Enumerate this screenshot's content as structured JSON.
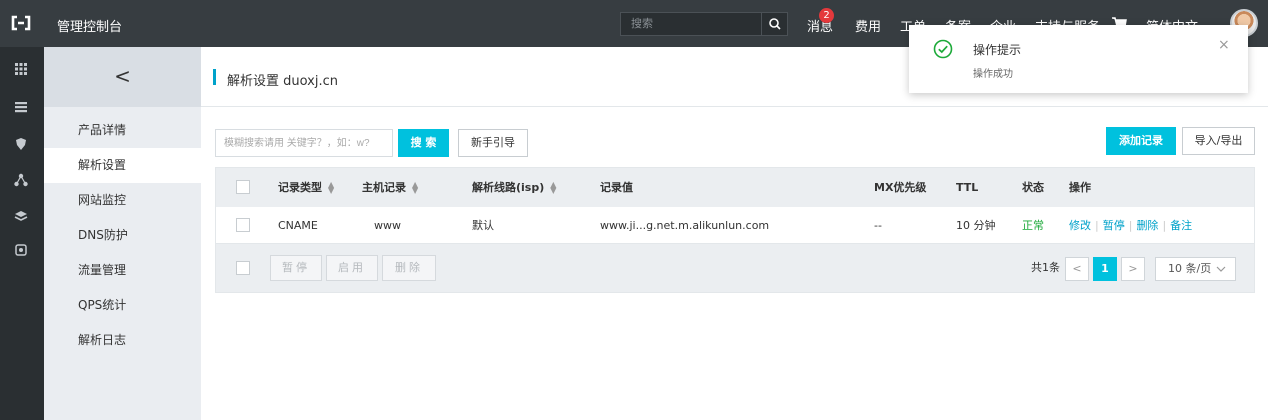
{
  "topbar": {
    "brand": "管理控制台",
    "search_placeholder": "搜索",
    "messages_label": "消息",
    "messages_count": "2",
    "nav": [
      "费用",
      "工单",
      "备案",
      "企业",
      "支持与服务",
      "简体中文"
    ]
  },
  "sidebar": {
    "back_label": "<",
    "items": [
      "产品详情",
      "解析设置",
      "网站监控",
      "DNS防护",
      "流量管理",
      "QPS统计",
      "解析日志"
    ],
    "active_index": 1
  },
  "page": {
    "title": "解析设置 duoxj.cn"
  },
  "toolbar": {
    "keyword_placeholder": "模糊搜索请用 关键字？，如：w?",
    "search_label": "搜 索",
    "guide_label": "新手引导",
    "add_label": "添加记录",
    "import_export_label": "导入/导出"
  },
  "table": {
    "headers": [
      "记录类型",
      "主机记录",
      "解析线路(isp)",
      "记录值",
      "MX优先级",
      "TTL",
      "状态",
      "操作"
    ],
    "rows": [
      {
        "type": "CNAME",
        "host": "www",
        "line": "默认",
        "value": "www.ji...g.net.m.alikunlun.com",
        "mx": "--",
        "ttl": "10 分钟",
        "status": "正常",
        "actions": [
          "修改",
          "暂停",
          "删除",
          "备注"
        ]
      }
    ],
    "footer": {
      "pause_label": "暂停",
      "enable_label": "启用",
      "delete_label": "删除",
      "total": "共1条",
      "prev": "<",
      "current_page": "1",
      "next": ">",
      "page_size": "10 条/页"
    }
  },
  "toast": {
    "title": "操作提示",
    "message": "操作成功",
    "close": "×"
  },
  "colors": {
    "topbar": "#373d41",
    "accent": "#00c1de",
    "link": "#00a2ca",
    "success": "#1daa3a",
    "badge": "#e4393c"
  }
}
